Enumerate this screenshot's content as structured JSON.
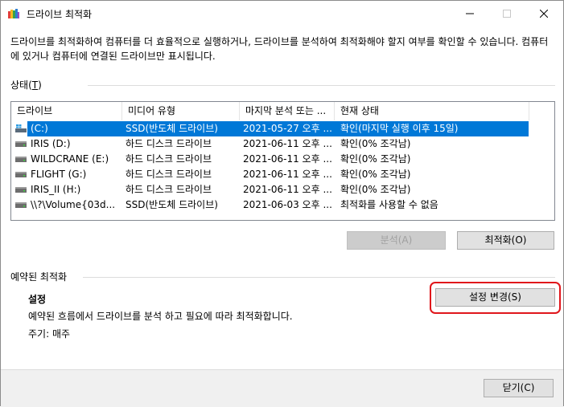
{
  "window": {
    "title": "드라이브 최적화",
    "minimize_glyph": "—",
    "maximize_glyph": "☐",
    "close_glyph": "✕"
  },
  "description": "드라이브를 최적화하여 컴퓨터를 더 효율적으로 실행하거나, 드라이브를 분석하여 최적화해야 할지 여부를 확인할 수 있습니다. 컴퓨터에 있거나 컴퓨터에 연결된 드라이브만 표시됩니다.",
  "status_section": {
    "label": "상태(",
    "mnemonic": "T",
    "label_end": ")"
  },
  "drive_list": {
    "columns": [
      "드라이브",
      "미디어 유형",
      "마지막 분석 또는 ...",
      "현재 상태"
    ],
    "rows": [
      {
        "drive": "(C:)",
        "media": "SSD(반도체 드라이브)",
        "last": "2021-05-27 오후 ...",
        "status": "확인(마지막 실행 이후 15일)",
        "icon": "windows-drive-icon",
        "selected": true
      },
      {
        "drive": "IRIS (D:)",
        "media": "하드 디스크 드라이브",
        "last": "2021-06-11 오후 ...",
        "status": "확인(0% 조각남)",
        "icon": "hard-drive-icon",
        "selected": false
      },
      {
        "drive": "WILDCRANE (E:)",
        "media": "하드 디스크 드라이브",
        "last": "2021-06-11 오후 ...",
        "status": "확인(0% 조각남)",
        "icon": "hard-drive-icon",
        "selected": false
      },
      {
        "drive": "FLIGHT (G:)",
        "media": "하드 디스크 드라이브",
        "last": "2021-06-11 오후 ...",
        "status": "확인(0% 조각남)",
        "icon": "hard-drive-icon",
        "selected": false
      },
      {
        "drive": "IRIS_II (H:)",
        "media": "하드 디스크 드라이브",
        "last": "2021-06-11 오후 ...",
        "status": "확인(0% 조각남)",
        "icon": "hard-drive-icon",
        "selected": false
      },
      {
        "drive": "\\\\?\\Volume{03d...",
        "media": "SSD(반도체 드라이브)",
        "last": "2021-06-03 오후 ...",
        "status": "최적화를 사용할 수 없음",
        "icon": "hard-drive-icon",
        "selected": false
      }
    ]
  },
  "buttons": {
    "analyze": "분석(A)",
    "optimize": "최적화(O)",
    "change_settings": "설정 변경(S)",
    "close": "닫기(C)"
  },
  "scheduled": {
    "label": "예약된 최적화",
    "settings_heading": "설정",
    "settings_desc": "예약된 흐름에서 드라이브를 분석 하고 필요에 따라 최적화합니다.",
    "frequency": "주기: 매주"
  },
  "colors": {
    "selection": "#0078d7",
    "highlight_border": "#e0161b"
  }
}
